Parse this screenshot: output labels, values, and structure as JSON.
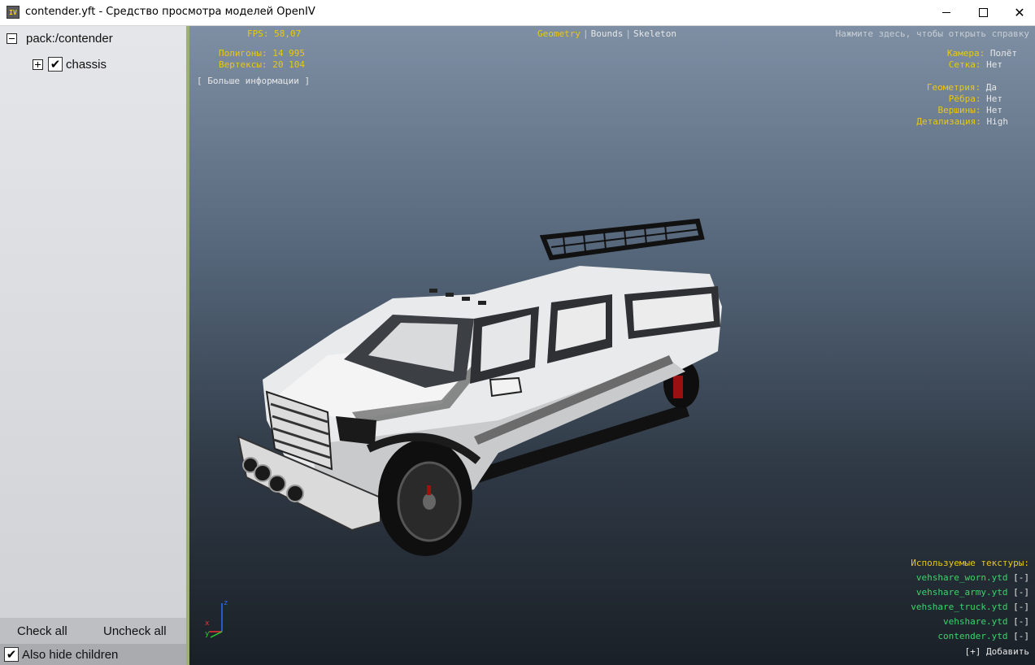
{
  "window": {
    "app_icon_text": "IV",
    "title": "contender.yft - Средство просмотра моделей OpenIV",
    "controls": {
      "minimize": "minimize",
      "maximize": "maximize",
      "close": "✕"
    }
  },
  "tree": {
    "root": {
      "label": "pack:/contender",
      "expanded": true
    },
    "children": [
      {
        "label": "chassis",
        "checked": true,
        "expanded": false
      }
    ]
  },
  "buttons": {
    "check_all": "Check all",
    "uncheck_all": "Uncheck all"
  },
  "also_hide_children": {
    "label": "Also hide children",
    "checked": true
  },
  "viewport": {
    "fps_label": "FPS:",
    "fps_value": "58,07",
    "polygons_label": "Полигоны:",
    "polygons_value": "14 995",
    "vertices_label": "Вертексы:",
    "vertices_value": "20 104",
    "more_info": "[ Больше информации ]",
    "tabs": {
      "geometry": "Geometry",
      "bounds": "Bounds",
      "skeleton": "Skeleton",
      "separator": "|",
      "active": "Geometry"
    },
    "help": "Нажмите здесь, чтобы открыть справку",
    "settings": [
      {
        "label": "Камера:",
        "value": "Полёт"
      },
      {
        "label": "Сетка:",
        "value": "Нет"
      },
      {
        "label": "Геометрия:",
        "value": "Да"
      },
      {
        "label": "Рёбра:",
        "value": "Нет"
      },
      {
        "label": "Вершины:",
        "value": "Нет"
      },
      {
        "label": "Детализация:",
        "value": "High"
      }
    ],
    "textures_header": "Используемые текстуры:",
    "textures": [
      {
        "name": "vehshare_worn.ytd",
        "remove": "[-]"
      },
      {
        "name": "vehshare_army.ytd",
        "remove": "[-]"
      },
      {
        "name": "vehshare_truck.ytd",
        "remove": "[-]"
      },
      {
        "name": "vehshare.ytd",
        "remove": "[-]"
      },
      {
        "name": "contender.ytd",
        "remove": "[-]"
      }
    ],
    "add_texture": "[+] Добавить",
    "axes": {
      "z": "z",
      "x": "x",
      "y": "y"
    }
  },
  "colors": {
    "overlay_yellow": "#e8c814",
    "overlay_green": "#3cd46a",
    "overlay_white": "#e6e6e6",
    "splitter": "#9dae7a"
  }
}
